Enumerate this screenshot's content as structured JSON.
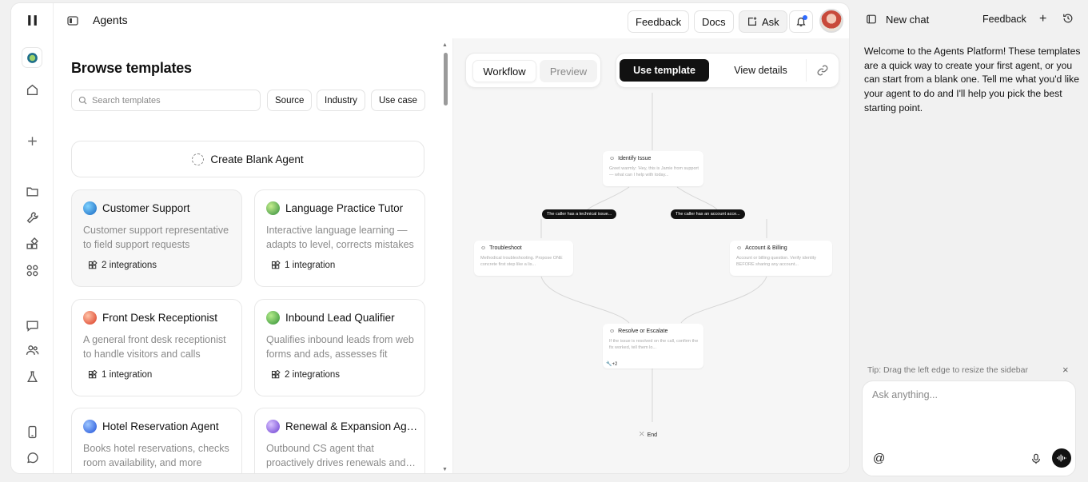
{
  "header": {
    "title": "Agents",
    "feedback_label": "Feedback",
    "docs_label": "Docs",
    "ask_label": "Ask"
  },
  "rail": {
    "icons": [
      "pause-icon",
      "logo-icon",
      "home-icon",
      "plus-icon",
      "folder-icon",
      "tools-icon",
      "integrations-icon",
      "apps-icon",
      "chat-bubble-icon",
      "users-icon",
      "flask-icon",
      "phone-icon",
      "whatsapp-icon"
    ]
  },
  "browse": {
    "title": "Browse templates",
    "search_placeholder": "Search templates",
    "filters": [
      "Source",
      "Industry",
      "Use case"
    ],
    "blank_label": "Create Blank Agent",
    "templates": [
      {
        "name": "Customer Support",
        "description": "Customer support representative to field support requests",
        "integrations": "2 integrations",
        "color": "#3aa0e6"
      },
      {
        "name": "Language Practice Tutor",
        "description": "Interactive language learning — adapts to level, corrects mistakes",
        "integrations": "1 integration",
        "color": "#5bbd4a"
      },
      {
        "name": "Front Desk Receptionist",
        "description": "A general front desk receptionist to handle visitors and calls",
        "integrations": "1 integration",
        "color": "#e8573c"
      },
      {
        "name": "Inbound Lead Qualifier",
        "description": "Qualifies inbound leads from web forms and ads, assesses fit",
        "integrations": "2 integrations",
        "color": "#4caf50"
      },
      {
        "name": "Hotel Reservation Agent",
        "description": "Books hotel reservations, checks room availability, and more",
        "integrations": "",
        "color": "#3b82f6"
      },
      {
        "name": "Renewal & Expansion Agent",
        "description": "Outbound CS agent that proactively drives renewals and upsells",
        "integrations": "",
        "color": "#8b5cf6"
      }
    ]
  },
  "preview": {
    "tab_workflow": "Workflow",
    "tab_preview": "Preview",
    "use_template": "Use template",
    "view_details": "View details",
    "nodes": {
      "identify": {
        "title": "Identify Issue",
        "desc": "Greet warmly: 'Hey, this is Jamie from support — what can I help with today..."
      },
      "troubleshoot": {
        "title": "Troubleshoot",
        "desc": "Methodical troubleshooting. Propose ONE concrete first step like a lis..."
      },
      "billing": {
        "title": "Account & Billing",
        "desc": "Account or billing question. Verify identity BEFORE sharing any account..."
      },
      "resolve": {
        "title": "Resolve or Escalate",
        "desc": "If the issue is resolved on the call, confirm the fix worked, tell them lo...",
        "extra": "+2"
      },
      "end": {
        "title": "End"
      }
    },
    "edge_left": "The caller has a technical issue...",
    "edge_right": "The caller has an account acce..."
  },
  "chat": {
    "title": "New chat",
    "feedback_label": "Feedback",
    "welcome": "Welcome to the Agents Platform! These templates are a quick way to create your first agent, or you can start from a blank one. Tell me what you'd like your agent to do and I'll help you pick the best starting point.",
    "tip": "Tip: Drag the left edge to resize the sidebar",
    "input_placeholder": "Ask anything..."
  }
}
